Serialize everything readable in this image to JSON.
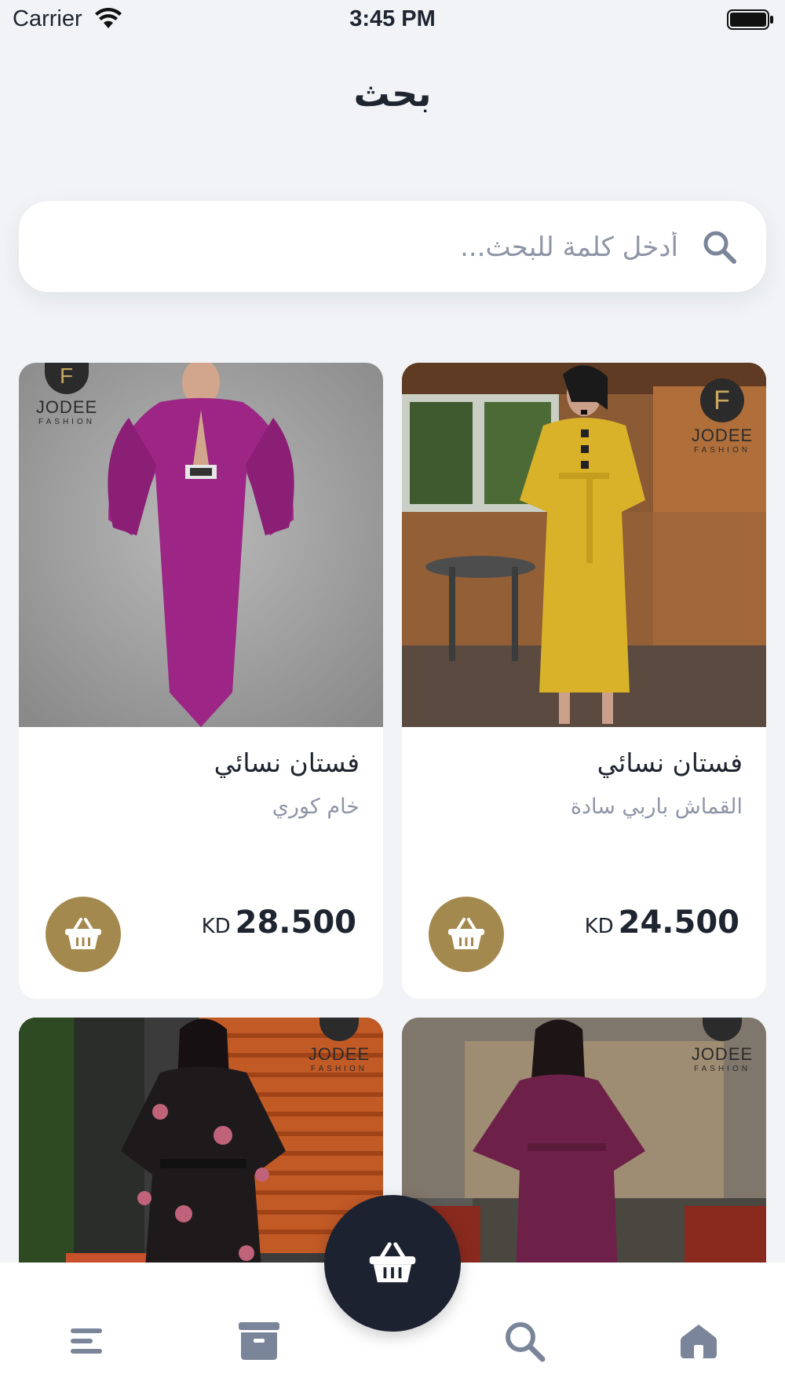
{
  "status_bar": {
    "carrier": "Carrier",
    "time": "3:45 PM"
  },
  "page": {
    "title": "بحث"
  },
  "search": {
    "placeholder": "أدخل كلمة للبحث..."
  },
  "products": [
    {
      "name": "فستان نسائي",
      "description": "القماش باربي سادة",
      "price": "24.500",
      "currency": "KD",
      "brand": "JODEE",
      "brand_sub": "FASHION",
      "dress_color": "#d9b22a"
    },
    {
      "name": "فستان نسائي",
      "description": "خام كوري",
      "price": "28.500",
      "currency": "KD",
      "brand": "JODEE",
      "brand_sub": "FASHION",
      "dress_color": "#9c2585"
    },
    {
      "name": "",
      "description": "",
      "price": "",
      "currency": "",
      "brand": "JODEE",
      "brand_sub": "FASHION",
      "dress_color": "#6e2148"
    },
    {
      "name": "",
      "description": "",
      "price": "",
      "currency": "",
      "brand": "JODEE",
      "brand_sub": "FASHION",
      "dress_color": "#1e1a1c"
    }
  ],
  "tab_bar": {
    "items": [
      {
        "icon": "home-icon"
      },
      {
        "icon": "search-icon"
      },
      {
        "icon": "cart-icon"
      },
      {
        "icon": "archive-icon"
      },
      {
        "icon": "menu-icon"
      }
    ]
  },
  "colors": {
    "accent": "#a4894e",
    "dark": "#1c2230",
    "icon_gray": "#7b8599",
    "background": "#f1f3f6"
  }
}
